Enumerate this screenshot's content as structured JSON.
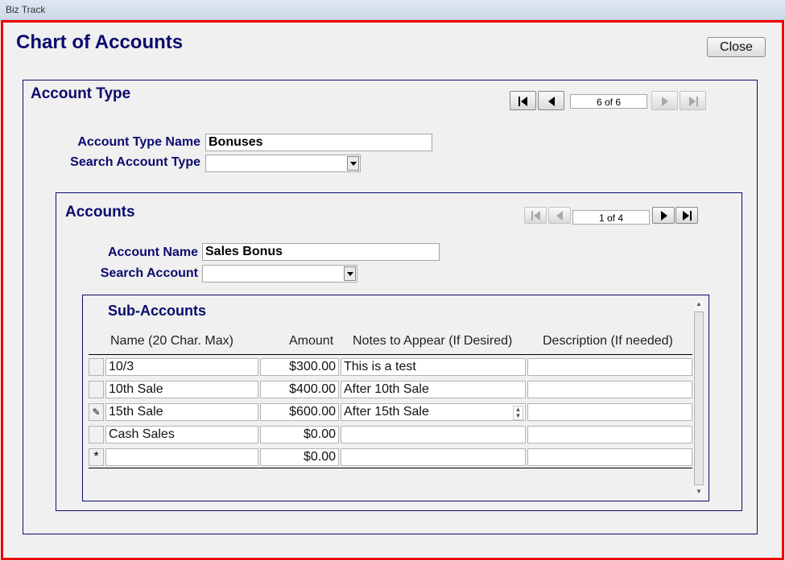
{
  "window": {
    "title": "Biz Track"
  },
  "form": {
    "title": "Chart of Accounts",
    "close_label": "Close"
  },
  "account_type": {
    "section_title": "Account Type",
    "nav_counter": "6 of 6",
    "name_label": "Account Type Name",
    "name_value": "Bonuses",
    "search_label": "Search Account Type",
    "search_value": ""
  },
  "accounts": {
    "section_title": "Accounts",
    "nav_counter": "1 of 4",
    "name_label": "Account Name",
    "name_value": "Sales Bonus",
    "search_label": "Search Account",
    "search_value": ""
  },
  "sub_accounts": {
    "section_title": "Sub-Accounts",
    "columns": [
      "Name (20 Char. Max)",
      "Amount",
      "Notes to Appear (If Desired)",
      "Description (If needed)"
    ],
    "rows": [
      {
        "selector": "",
        "name": "10/3",
        "amount": "$300.00",
        "notes": "This is a test",
        "description": ""
      },
      {
        "selector": "",
        "name": "10th Sale",
        "amount": "$400.00",
        "notes": "After 10th Sale",
        "description": ""
      },
      {
        "selector": "✎",
        "name": "15th Sale",
        "amount": "$600.00",
        "notes": "After 15th Sale",
        "description": ""
      },
      {
        "selector": "",
        "name": "Cash Sales",
        "amount": "$0.00",
        "notes": "",
        "description": ""
      },
      {
        "selector": "*",
        "name": "",
        "amount": "$0.00",
        "notes": "",
        "description": ""
      }
    ]
  },
  "colors": {
    "accent": "#0b0b6e",
    "frame": "#ee0000"
  }
}
